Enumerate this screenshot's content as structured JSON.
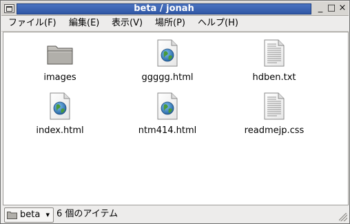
{
  "window": {
    "title": "beta / jonah"
  },
  "title_buttons": {
    "minimize": "_",
    "maximize": "□",
    "close": "×"
  },
  "menubar": {
    "items": [
      {
        "label": "ファイル(F)"
      },
      {
        "label": "編集(E)"
      },
      {
        "label": "表示(V)"
      },
      {
        "label": "場所(P)"
      },
      {
        "label": "ヘルプ(H)"
      }
    ]
  },
  "files": [
    {
      "name": "images",
      "type": "folder",
      "icon": "folder-icon"
    },
    {
      "name": "ggggg.html",
      "type": "html",
      "icon": "html-file-icon"
    },
    {
      "name": "hdben.txt",
      "type": "text",
      "icon": "text-file-icon"
    },
    {
      "name": "index.html",
      "type": "html",
      "icon": "html-file-icon"
    },
    {
      "name": "ntm414.html",
      "type": "html",
      "icon": "html-file-icon"
    },
    {
      "name": "readmejp.css",
      "type": "text",
      "icon": "text-file-icon"
    }
  ],
  "statusbar": {
    "location": "beta",
    "item_count": "6 個のアイテム"
  },
  "colors": {
    "titlebar_active": "#3a63b2",
    "window_bg": "#edeceb",
    "content_bg": "#ffffff",
    "globe_blue": "#2f7fc8",
    "globe_green": "#4a9a3a"
  }
}
